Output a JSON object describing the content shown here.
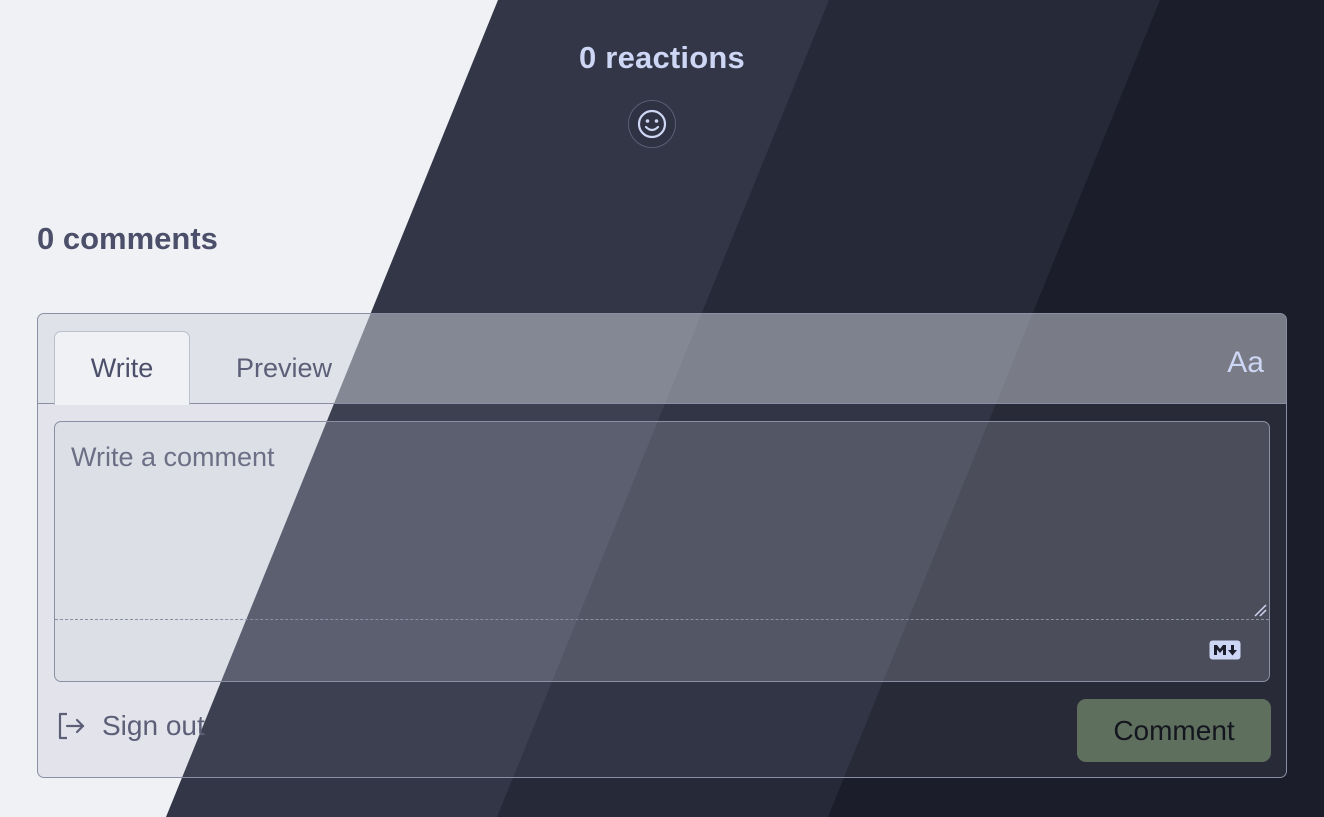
{
  "reactions": {
    "count_label": "0 reactions",
    "icon": "smiley-icon"
  },
  "comments": {
    "count_label": "0 comments"
  },
  "editor": {
    "tabs": [
      {
        "label": "Write",
        "active": true
      },
      {
        "label": "Preview",
        "active": false
      }
    ],
    "font_toggle_label": "Aa",
    "placeholder": "Write a comment",
    "value": "",
    "markdown_icon": "markdown-icon"
  },
  "actions": {
    "sign_out_label": "Sign out",
    "sign_out_icon": "sign-out-icon",
    "comment_label": "Comment"
  },
  "colors": {
    "accent_button": "#5e6f5d",
    "light_bg": "#eff1f5",
    "dark_band_1": "#333646",
    "dark_band_2": "#262938",
    "dark_band_3": "#1c1d2a"
  }
}
